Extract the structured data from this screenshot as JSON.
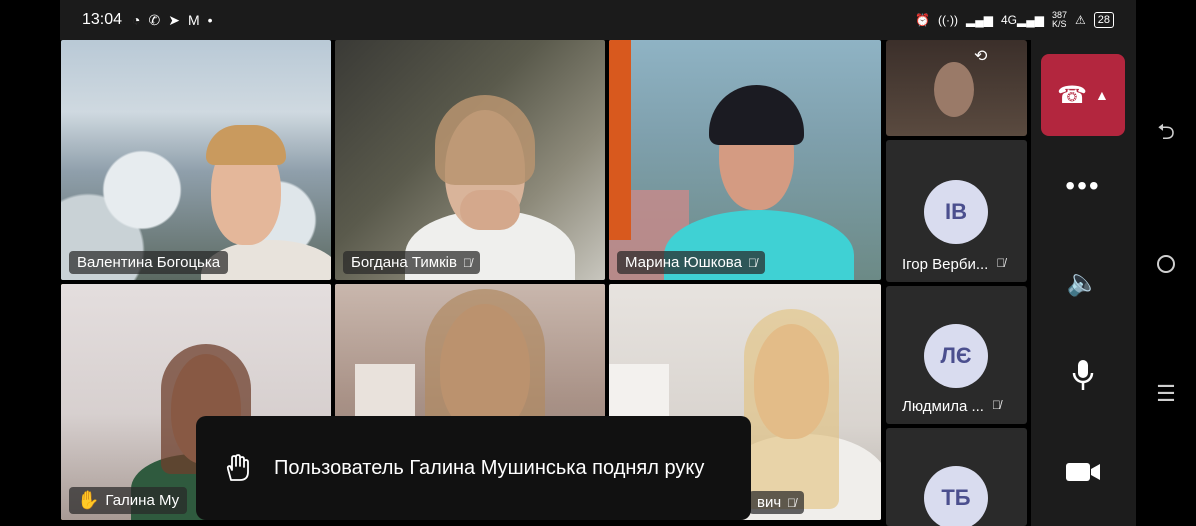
{
  "status_bar": {
    "time": "13:04",
    "left_icons": [
      "whatsapp-icon",
      "phone-icon",
      "telegram-icon",
      "gmail-icon",
      "dot-icon"
    ],
    "right_text": {
      "speed": "387",
      "speed_unit": "K/S",
      "battery": "28"
    }
  },
  "participants": [
    {
      "name": "Валентина Богоцька",
      "muted": false
    },
    {
      "name": "Богдана Тимків",
      "muted": true
    },
    {
      "name": "Марина Юшкова",
      "muted": true
    },
    {
      "name": "Галина Му",
      "muted": false,
      "hand_raised": true
    },
    {
      "name": "",
      "muted": false
    },
    {
      "name": "вич",
      "muted": true
    }
  ],
  "side_participants": [
    {
      "initials": "",
      "name": ""
    },
    {
      "initials": "ІВ",
      "name": "Ігор Верби..."
    },
    {
      "initials": "ЛЄ",
      "name": "Людмила ..."
    },
    {
      "initials": "ТБ",
      "name": ""
    }
  ],
  "toast": {
    "message": "Пользователь Галина Мушинська поднял руку"
  },
  "controls": [
    "leave-call",
    "more",
    "speaker",
    "microphone",
    "camera"
  ],
  "colors": {
    "leave": "#b3263e",
    "raised_hand_outline": "#e6b94a",
    "active_speaker_outline": "#7e79d8"
  }
}
